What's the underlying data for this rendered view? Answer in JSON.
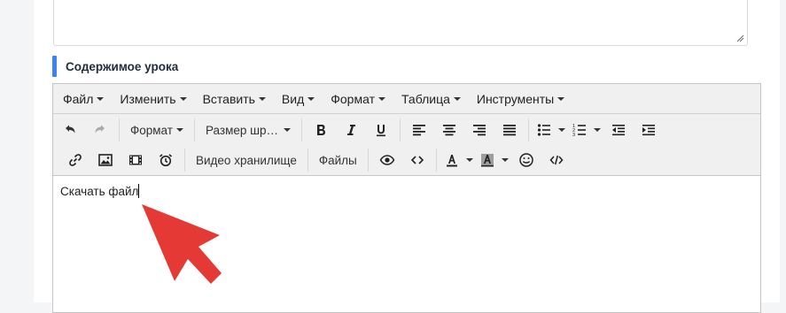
{
  "section": {
    "title": "Содержимое урока"
  },
  "editor": {
    "menubar": [
      "Файл",
      "Изменить",
      "Вставить",
      "Вид",
      "Формат",
      "Таблица",
      "Инструменты"
    ],
    "toolbar": {
      "format_label": "Формат",
      "font_size_label": "Размер шр…",
      "video_storage_label": "Видео хранилище",
      "files_label": "Файлы"
    },
    "content_text": "Скачать файл"
  },
  "colors": {
    "accent": "#3b82f6",
    "annotation_arrow": "#e53935"
  }
}
